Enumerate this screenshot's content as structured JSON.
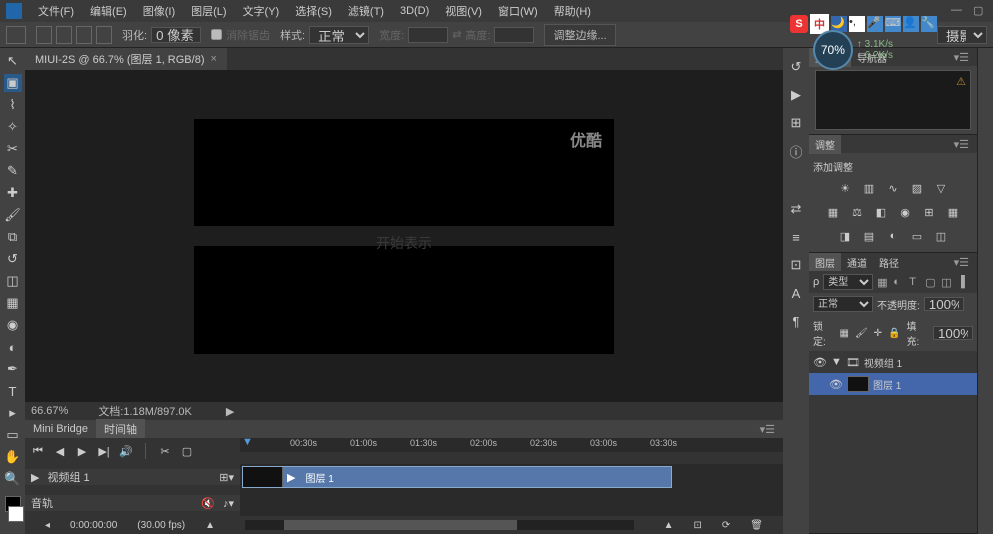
{
  "menu": {
    "file": "文件(F)",
    "edit": "编辑(E)",
    "image": "图像(I)",
    "layer": "图层(L)",
    "type": "文字(Y)",
    "select": "选择(S)",
    "filter": "滤镜(T)",
    "threed": "3D(D)",
    "view": "视图(V)",
    "window": "窗口(W)",
    "help": "帮助(H)"
  },
  "options": {
    "feather_label": "羽化:",
    "feather_value": "0 像素",
    "antialias_label": "消除锯齿",
    "style_label": "样式:",
    "style_value": "正常",
    "width_label": "宽度:",
    "height_label": "高度:",
    "refine_edge": "调整边缘..."
  },
  "taskbar": {
    "ime_char": "中"
  },
  "speed": {
    "percent": "70%",
    "up": "3.1K/s",
    "down": "6.2K/s"
  },
  "doc": {
    "tab_title": "MIUI-2S @ 66.7% (图层 1, RGB/8)",
    "watermark": "优酷",
    "caption": "开始表示"
  },
  "status": {
    "zoom": "66.67%",
    "docinfo": "文档:1.18M/897.0K"
  },
  "minitabs": {
    "bridge": "Mini Bridge",
    "timeline": "时间轴"
  },
  "timeline": {
    "ticks": [
      "00:30s",
      "01:00s",
      "01:30s",
      "02:00s",
      "02:30s",
      "03:00s",
      "03:30s"
    ],
    "group_name": "视频组 1",
    "clip_label": "图层 1",
    "audio_track": "音轨"
  },
  "bottomstatus": {
    "time": "0:00:00:00",
    "fps": "(30.00 fps)"
  },
  "panels": {
    "histogram_tab": "直方图",
    "navigator_tab": "导航器",
    "adjustments_tab": "调整",
    "adjust_header": "添加调整",
    "layers_tab": "图层",
    "channels_tab": "通道",
    "paths_tab": "路径",
    "kind_label": "类型",
    "blend_mode": "正常",
    "opacity_label": "不透明度:",
    "opacity_value": "100%",
    "lock_label": "锁定:",
    "fill_label": "填充:",
    "fill_value": "100%",
    "video_group": "视频组 1",
    "layer1": "图层 1"
  },
  "workspace": {
    "label": "摄影"
  }
}
